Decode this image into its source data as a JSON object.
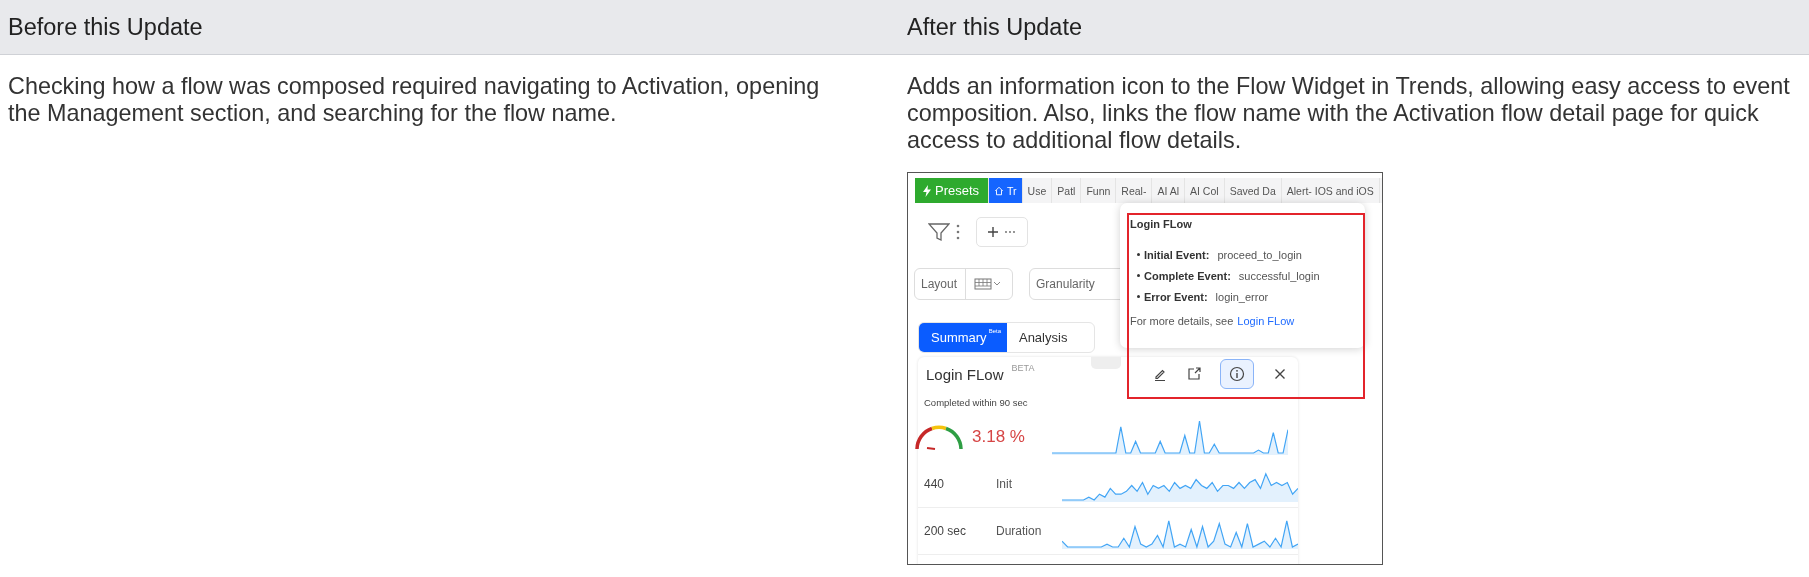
{
  "table": {
    "columns": [
      "Before this Update",
      "After this Update"
    ],
    "rows": [
      {
        "before": "Checking how a flow was composed required navigating to Activation, opening the Management section, and searching for the flow name.",
        "after": "Adds an information icon to the Flow Widget in Trends, allowing easy access to event composition. Also, links the flow name with the Activation flow detail page for quick access to additional flow details.",
        "screenshot": {
          "tabs": [
            {
              "label": "Presets",
              "kind": "preset",
              "selected": false
            },
            {
              "label": "Tr",
              "kind": "home",
              "selected": true
            },
            {
              "label": "Use",
              "kind": "plain",
              "selected": false
            },
            {
              "label": "Patl",
              "kind": "plain",
              "selected": false
            },
            {
              "label": "Funn",
              "kind": "plain",
              "selected": false
            },
            {
              "label": "Real-",
              "kind": "plain",
              "selected": false
            },
            {
              "label": "AI Al",
              "kind": "plain",
              "selected": false
            },
            {
              "label": "AI Col",
              "kind": "plain",
              "selected": false
            },
            {
              "label": "Saved Da",
              "kind": "plain",
              "selected": false
            },
            {
              "label": "Alert- IOS and iOS",
              "kind": "plain",
              "selected": false
            }
          ],
          "layout_label": "Layout",
          "granularity_label": "Granularity",
          "view_tabs": [
            {
              "label": "Summary",
              "superscript": "Beta",
              "selected": true
            },
            {
              "label": "Analysis",
              "selected": false
            }
          ],
          "widget": {
            "title": "Login FLow",
            "badge": "BETA",
            "subtitle": "Completed within 90 sec",
            "metrics": [
              {
                "kind": "gauge",
                "value": "3.18 %"
              },
              {
                "kind": "count",
                "value": "440",
                "label": "Init"
              },
              {
                "kind": "count",
                "value": "200 sec",
                "label": "Duration"
              }
            ]
          },
          "popover": {
            "title": "Login FLow",
            "items": [
              {
                "label": "Initial Event:",
                "value": "proceed_to_login"
              },
              {
                "label": "Complete Event:",
                "value": "successful_login"
              },
              {
                "label": "Error Event:",
                "value": "login_error"
              }
            ],
            "footer": "For more details, see",
            "link": "Login FLow"
          }
        }
      }
    ]
  }
}
